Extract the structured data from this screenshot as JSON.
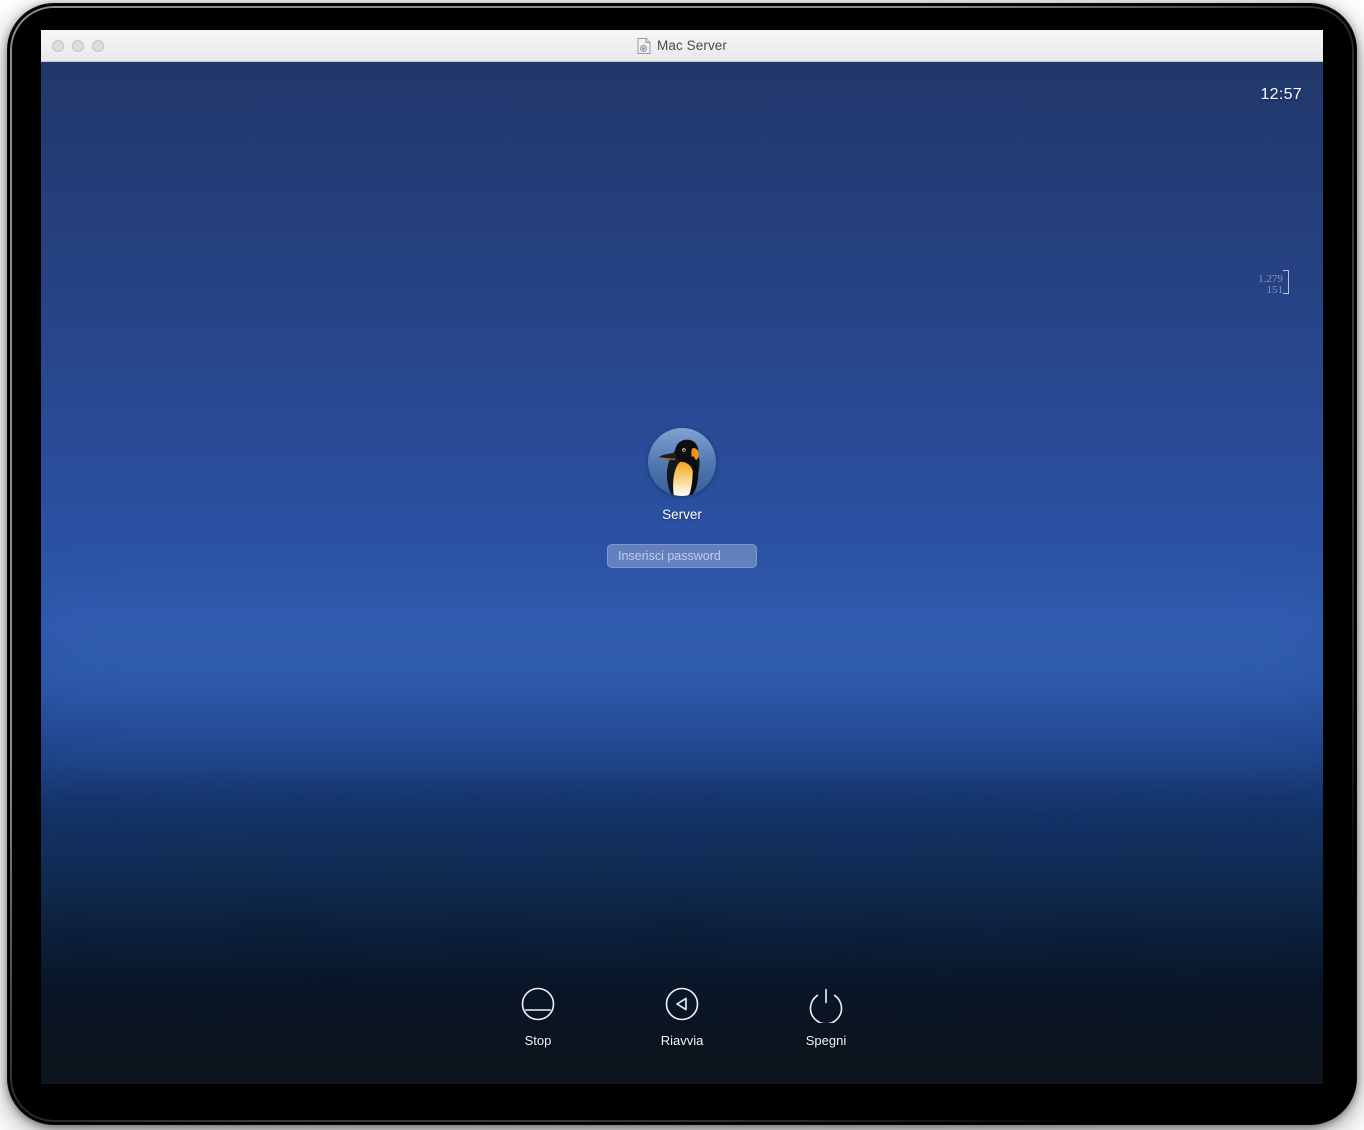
{
  "window": {
    "title": "Mac Server",
    "doc_icon": "document-icon",
    "traffic_lights": [
      {
        "name": "close-button",
        "color": "#dcdcdc"
      },
      {
        "name": "minimize-button",
        "color": "#dcdcdc"
      },
      {
        "name": "zoom-button",
        "color": "#dcdcdc"
      }
    ]
  },
  "screen": {
    "clock": "12:57",
    "artifact": {
      "line1": "1.279",
      "line2": "151"
    },
    "login": {
      "avatar_icon": "penguin-avatar",
      "username": "Server",
      "password_placeholder": "Inserisci password",
      "password_value": ""
    },
    "session_buttons": [
      {
        "label": "Stop",
        "icon": "suspend-icon"
      },
      {
        "label": "Riavvia",
        "icon": "restart-icon"
      },
      {
        "label": "Spegni",
        "icon": "power-icon"
      }
    ]
  },
  "colors": {
    "sky_top": "#21386c",
    "sky_mid": "#2d57ab",
    "ground_bottom": "#0d141c",
    "titlebar": "#f0f0f0",
    "text_light": "#ffffff"
  }
}
